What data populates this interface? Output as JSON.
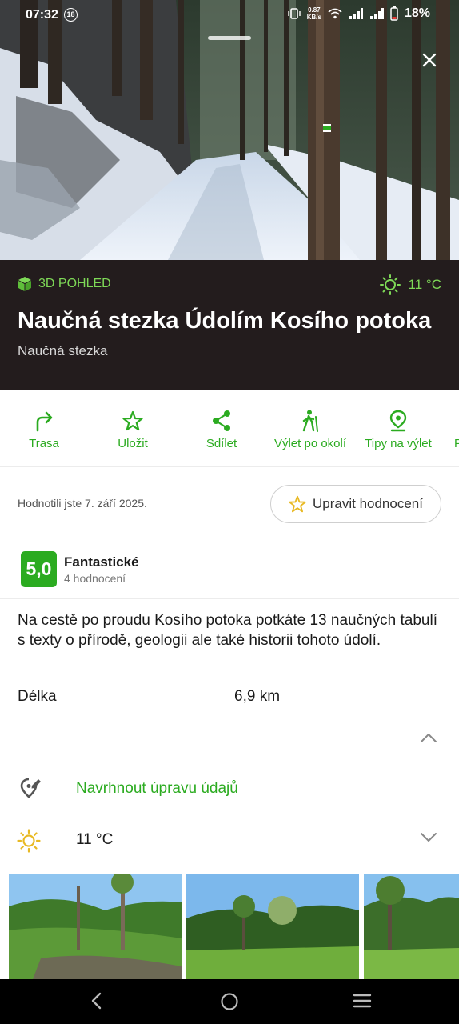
{
  "status_bar": {
    "time": "07:32",
    "notification_badge": "18",
    "speed_value": "0.87",
    "speed_unit": "KB/s",
    "battery": "18%"
  },
  "header": {
    "view3d_label": "3D POHLED",
    "temperature": "11 °C",
    "title": "Naučná stezka Údolím Kosího potoka",
    "subtitle": "Naučná stezka"
  },
  "actions": [
    {
      "label": "Trasa",
      "icon": "route-icon"
    },
    {
      "label": "Uložit",
      "icon": "star-icon"
    },
    {
      "label": "Sdílet",
      "icon": "share-icon"
    },
    {
      "label": "Výlet po okolí",
      "icon": "hiker-icon"
    },
    {
      "label": "Tipy na výlet",
      "icon": "location-pin-icon"
    }
  ],
  "rating": {
    "rated_text": "Hodnotili jste 7. září 2025.",
    "edit_button": "Upravit hodnocení",
    "score": "5,0",
    "score_label": "Fantastické",
    "count": "4 hodnocení"
  },
  "details": {
    "description": "Na cestě po proudu Kosího potoka potkáte 13 naučných tabulí s texty o přírodě, geologii ale také historii tohoto údolí.",
    "length_label": "Délka",
    "length_value": "6,9 km"
  },
  "suggest_edit": "Navrhnout úpravu údajů",
  "weather": {
    "temperature": "11 °C"
  },
  "colors": {
    "accent": "#2bab20",
    "accent_light": "#7ed957",
    "header_bg": "#231c1d"
  }
}
